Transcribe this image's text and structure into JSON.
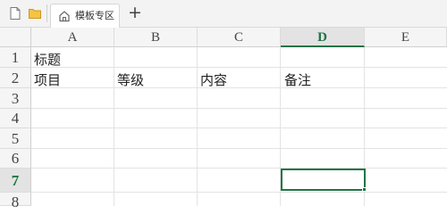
{
  "tabbar": {
    "tab_label": "模板专区",
    "new_tab_symbol": "+"
  },
  "sheet": {
    "columns": [
      "A",
      "B",
      "C",
      "D",
      "E"
    ],
    "rows": [
      "1",
      "2",
      "3",
      "4",
      "5",
      "6",
      "7",
      "8"
    ],
    "selected_column": "D",
    "selected_row": "7",
    "active_cell": "D7",
    "cells": {
      "A1": "标题",
      "A2": "项目",
      "B2": "等级",
      "C2": "内容",
      "D2": "备注"
    }
  },
  "colors": {
    "accent": "#217346",
    "header_bg": "#f5f5f5",
    "selected_header_bg": "#e3e3e3",
    "gridline": "#e3e3e3"
  }
}
